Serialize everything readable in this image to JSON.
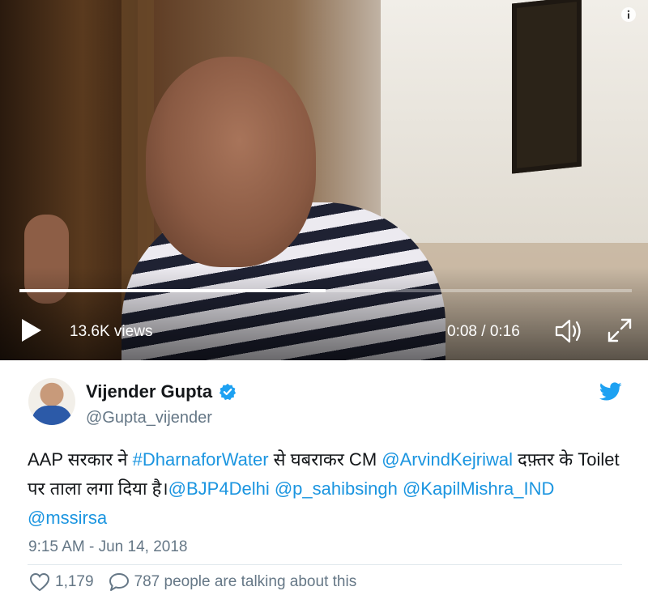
{
  "video": {
    "views": "13.6K views",
    "time": "0:08 / 0:16",
    "progress": 0.5
  },
  "tweet": {
    "author_name": "Vijender Gupta",
    "author_handle": "@Gupta_vijender",
    "text_segments": [
      {
        "text": "AAP सरकार ने ",
        "link": false
      },
      {
        "text": "#DharnaforWater",
        "link": true
      },
      {
        "text": " से घबराकर CM ",
        "link": false
      },
      {
        "text": "@ArvindKejriwal",
        "link": true
      },
      {
        "text": " दफ़्तर के Toilet पर ताला लगा दिया है।",
        "link": false
      },
      {
        "text": "@BJP4Delhi",
        "link": true
      },
      {
        "text": " ",
        "link": false
      },
      {
        "text": "@p_sahibsingh",
        "link": true
      },
      {
        "text": " ",
        "link": false
      },
      {
        "text": "@KapilMishra_IND",
        "link": true
      },
      {
        "text": " ",
        "link": false
      },
      {
        "text": "@mssirsa",
        "link": true
      }
    ],
    "timestamp": "9:15 AM - Jun 14, 2018",
    "likes": "1,179",
    "talking": "787 people are talking about this"
  },
  "colors": {
    "link": "#1b95e0",
    "muted": "#657786",
    "verified": "#1da1f2"
  },
  "icons": [
    "info-icon",
    "play-icon",
    "volume-icon",
    "fullscreen-icon",
    "verified-icon",
    "twitter-bird-icon",
    "heart-icon",
    "comment-icon"
  ]
}
